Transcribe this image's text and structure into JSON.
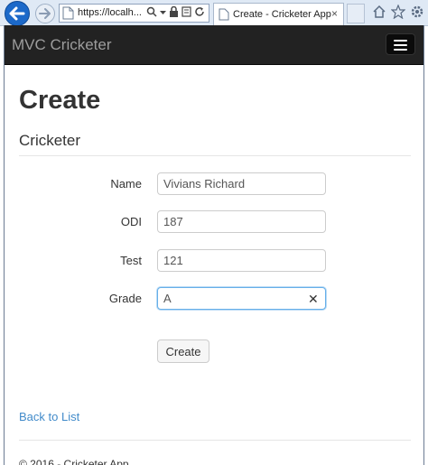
{
  "browser": {
    "url": "https://localh...",
    "tab_title": "Create - Cricketer App",
    "tab_close": "×"
  },
  "navbar": {
    "brand": "MVC Cricketer"
  },
  "page": {
    "heading": "Create",
    "subheading": "Cricketer"
  },
  "form": {
    "name_label": "Name",
    "name_value": "Vivians Richard",
    "odi_label": "ODI",
    "odi_value": "187",
    "test_label": "Test",
    "test_value": "121",
    "grade_label": "Grade",
    "grade_value": "A",
    "clear_glyph": "✕",
    "submit_label": "Create"
  },
  "links": {
    "back_to_list": "Back to List"
  },
  "footer": {
    "text": "© 2016 - Cricketer App"
  },
  "colors": {
    "navbar_bg": "#222222",
    "brand": "#9d9d9d",
    "link": "#428bca",
    "focus_border": "#66afe9",
    "back_button": "#1c69c9"
  },
  "icons": [
    "back-arrow-icon",
    "forward-arrow-icon",
    "page-icon",
    "search-icon",
    "lock-icon",
    "certificate-icon",
    "refresh-icon",
    "home-icon",
    "star-icon",
    "gear-icon",
    "hamburger-icon"
  ]
}
